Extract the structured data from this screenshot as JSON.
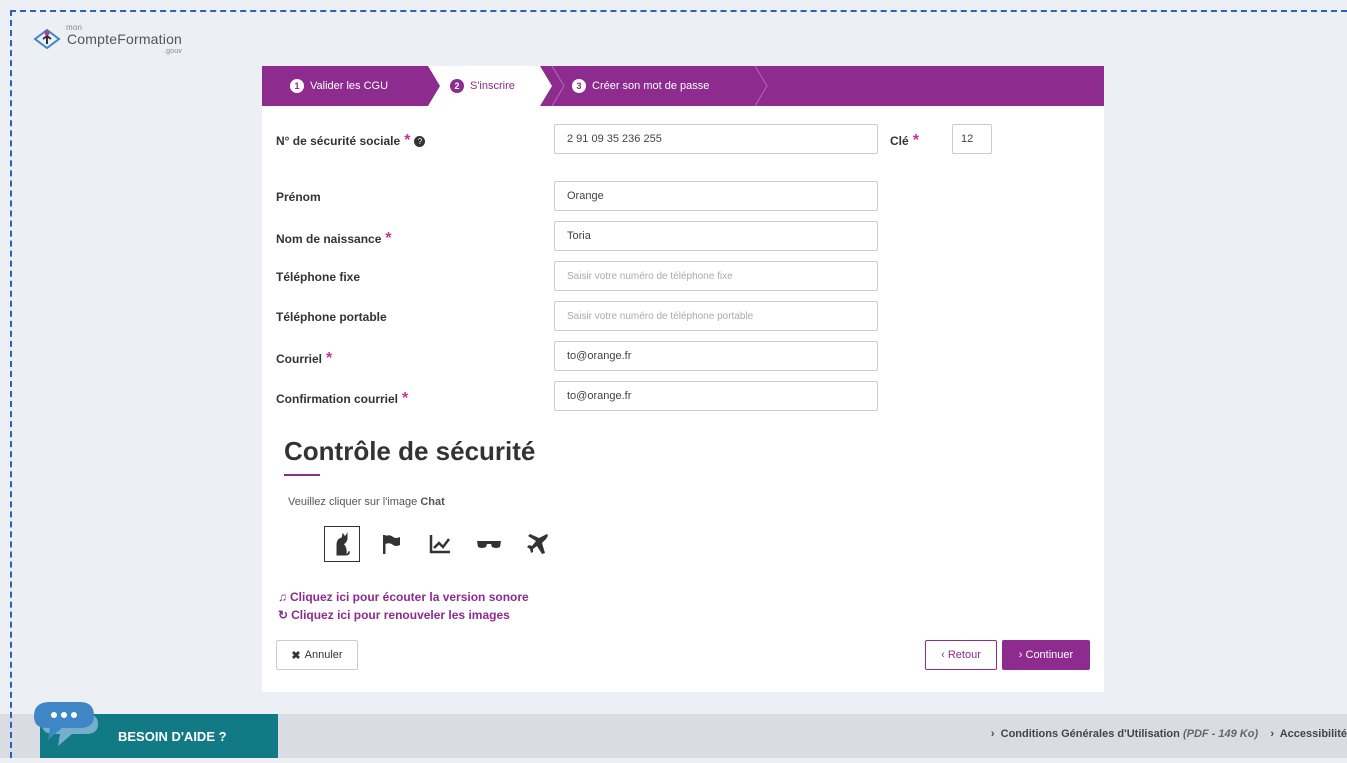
{
  "logo": {
    "prefix": "mon",
    "name": "CompteFormation",
    "suffix": ".gouv"
  },
  "steps": [
    {
      "num": "1",
      "label": "Valider les CGU",
      "active": false
    },
    {
      "num": "2",
      "label": "S'inscrire",
      "active": true
    },
    {
      "num": "3",
      "label": "Créer son mot de passe",
      "active": false
    }
  ],
  "form": {
    "ssn_label": "N° de sécurité sociale",
    "ssn_value": "2 91 09 35 236 255",
    "key_label": "Clé",
    "key_value": "12",
    "first_name_label": "Prénom",
    "first_name_value": "Orange",
    "birth_name_label": "Nom de naissance",
    "birth_name_value": "Toria",
    "landline_label": "Téléphone fixe",
    "landline_placeholder": "Saisir votre numéro de téléphone fixe",
    "mobile_label": "Téléphone portable",
    "mobile_placeholder": "Saisir votre numéro de téléphone portable",
    "email_label": "Courriel",
    "email_value": "to@orange.fr",
    "email_confirm_label": "Confirmation courriel",
    "email_confirm_value": "to@orange.fr",
    "required_mark": "*"
  },
  "captcha": {
    "title": "Contrôle de sécurité",
    "instruction": "Veuillez cliquer sur l'image",
    "target": "Chat",
    "images": [
      "cat-icon",
      "flag-icon",
      "chart-icon",
      "sunglasses-icon",
      "airplane-icon"
    ],
    "audio_link": "Cliquez ici pour écouter la version sonore",
    "refresh_link": "Cliquez ici pour renouveler les images"
  },
  "buttons": {
    "cancel": "Annuler",
    "back": "‹ Retour",
    "continue": "› Continuer"
  },
  "footer": {
    "help": "BESOIN D'AIDE ?",
    "cgu_link": "Conditions Générales d'Utilisation",
    "cgu_meta": "(PDF - 149 Ko)",
    "accessibility_link": "Accessibilité"
  },
  "colors": {
    "brand": "#8d2b8f",
    "help_teal": "#127a85",
    "chat_blue": "#3f86c6"
  }
}
